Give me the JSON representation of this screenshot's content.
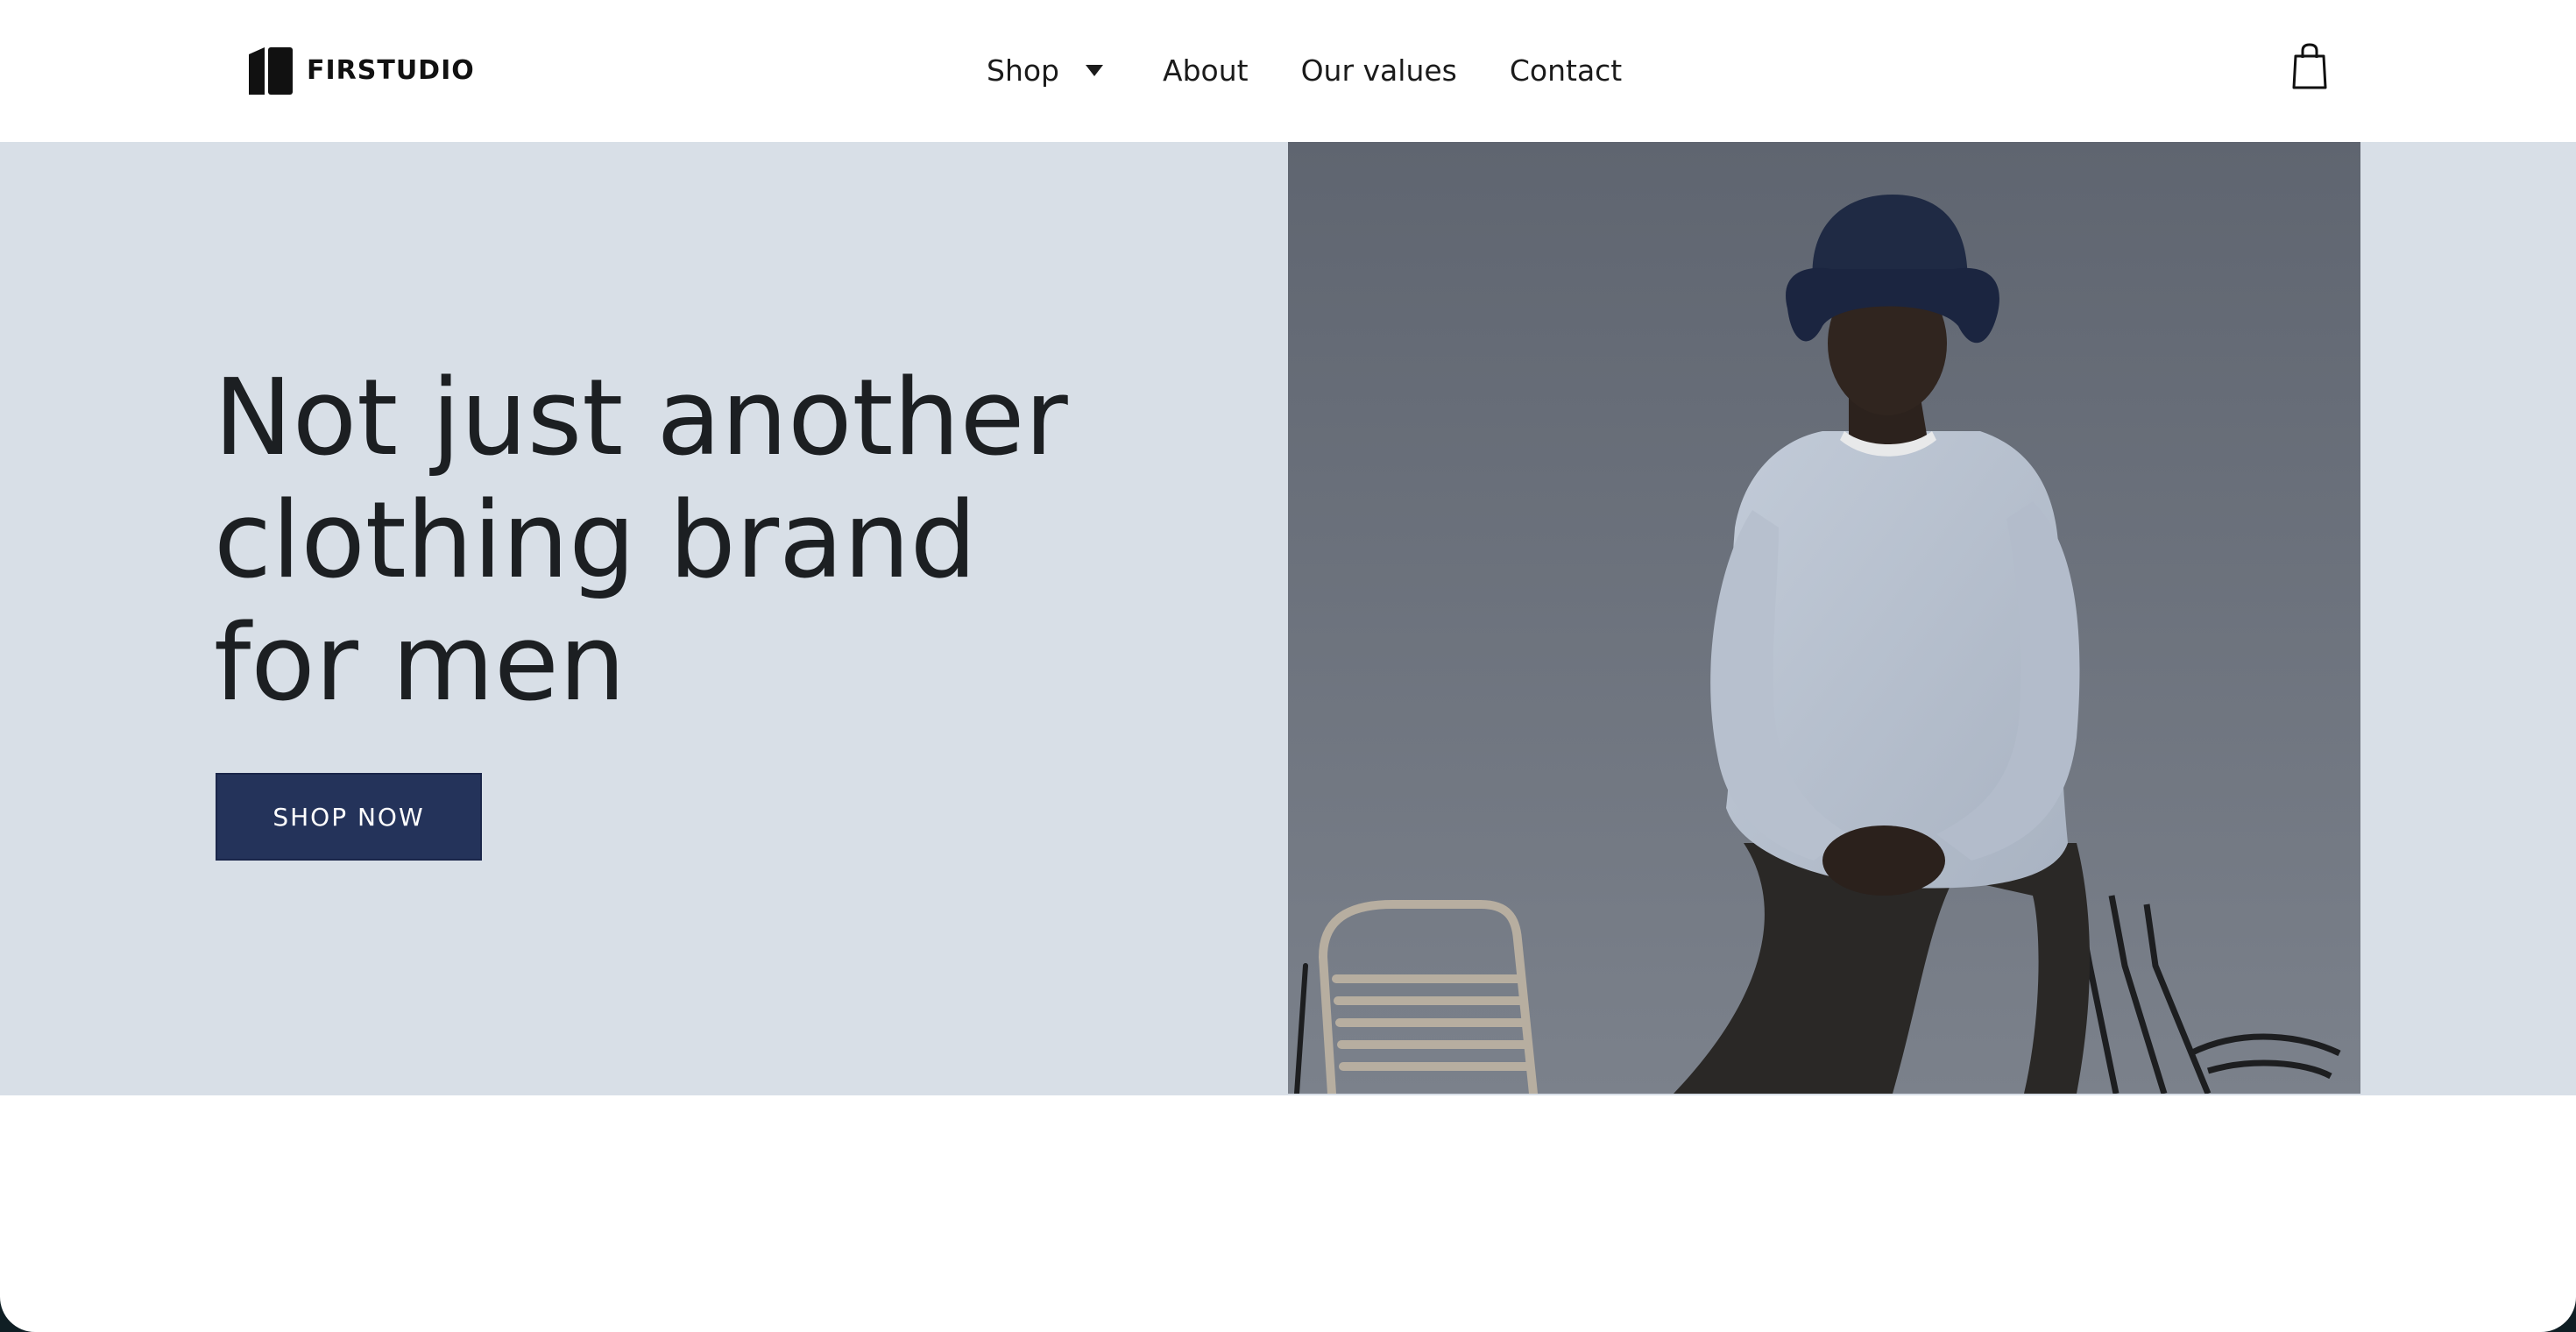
{
  "brand": {
    "name": "FIRSTUDIO"
  },
  "nav": {
    "items": [
      {
        "label": "Shop",
        "has_dropdown": true
      },
      {
        "label": "About"
      },
      {
        "label": "Our values"
      },
      {
        "label": "Contact"
      }
    ]
  },
  "header": {
    "cart_icon": "shopping-bag-icon"
  },
  "hero": {
    "headline_lines": [
      "Not just another",
      "clothing brand",
      "for men"
    ],
    "cta_label": "SHOP NOW",
    "image": "man-in-bucket-hat-and-sweatshirt-photo"
  },
  "colors": {
    "hero_background": "#d8dfe7",
    "cta_background": "#24335a",
    "text_dark": "#1c1f22"
  }
}
